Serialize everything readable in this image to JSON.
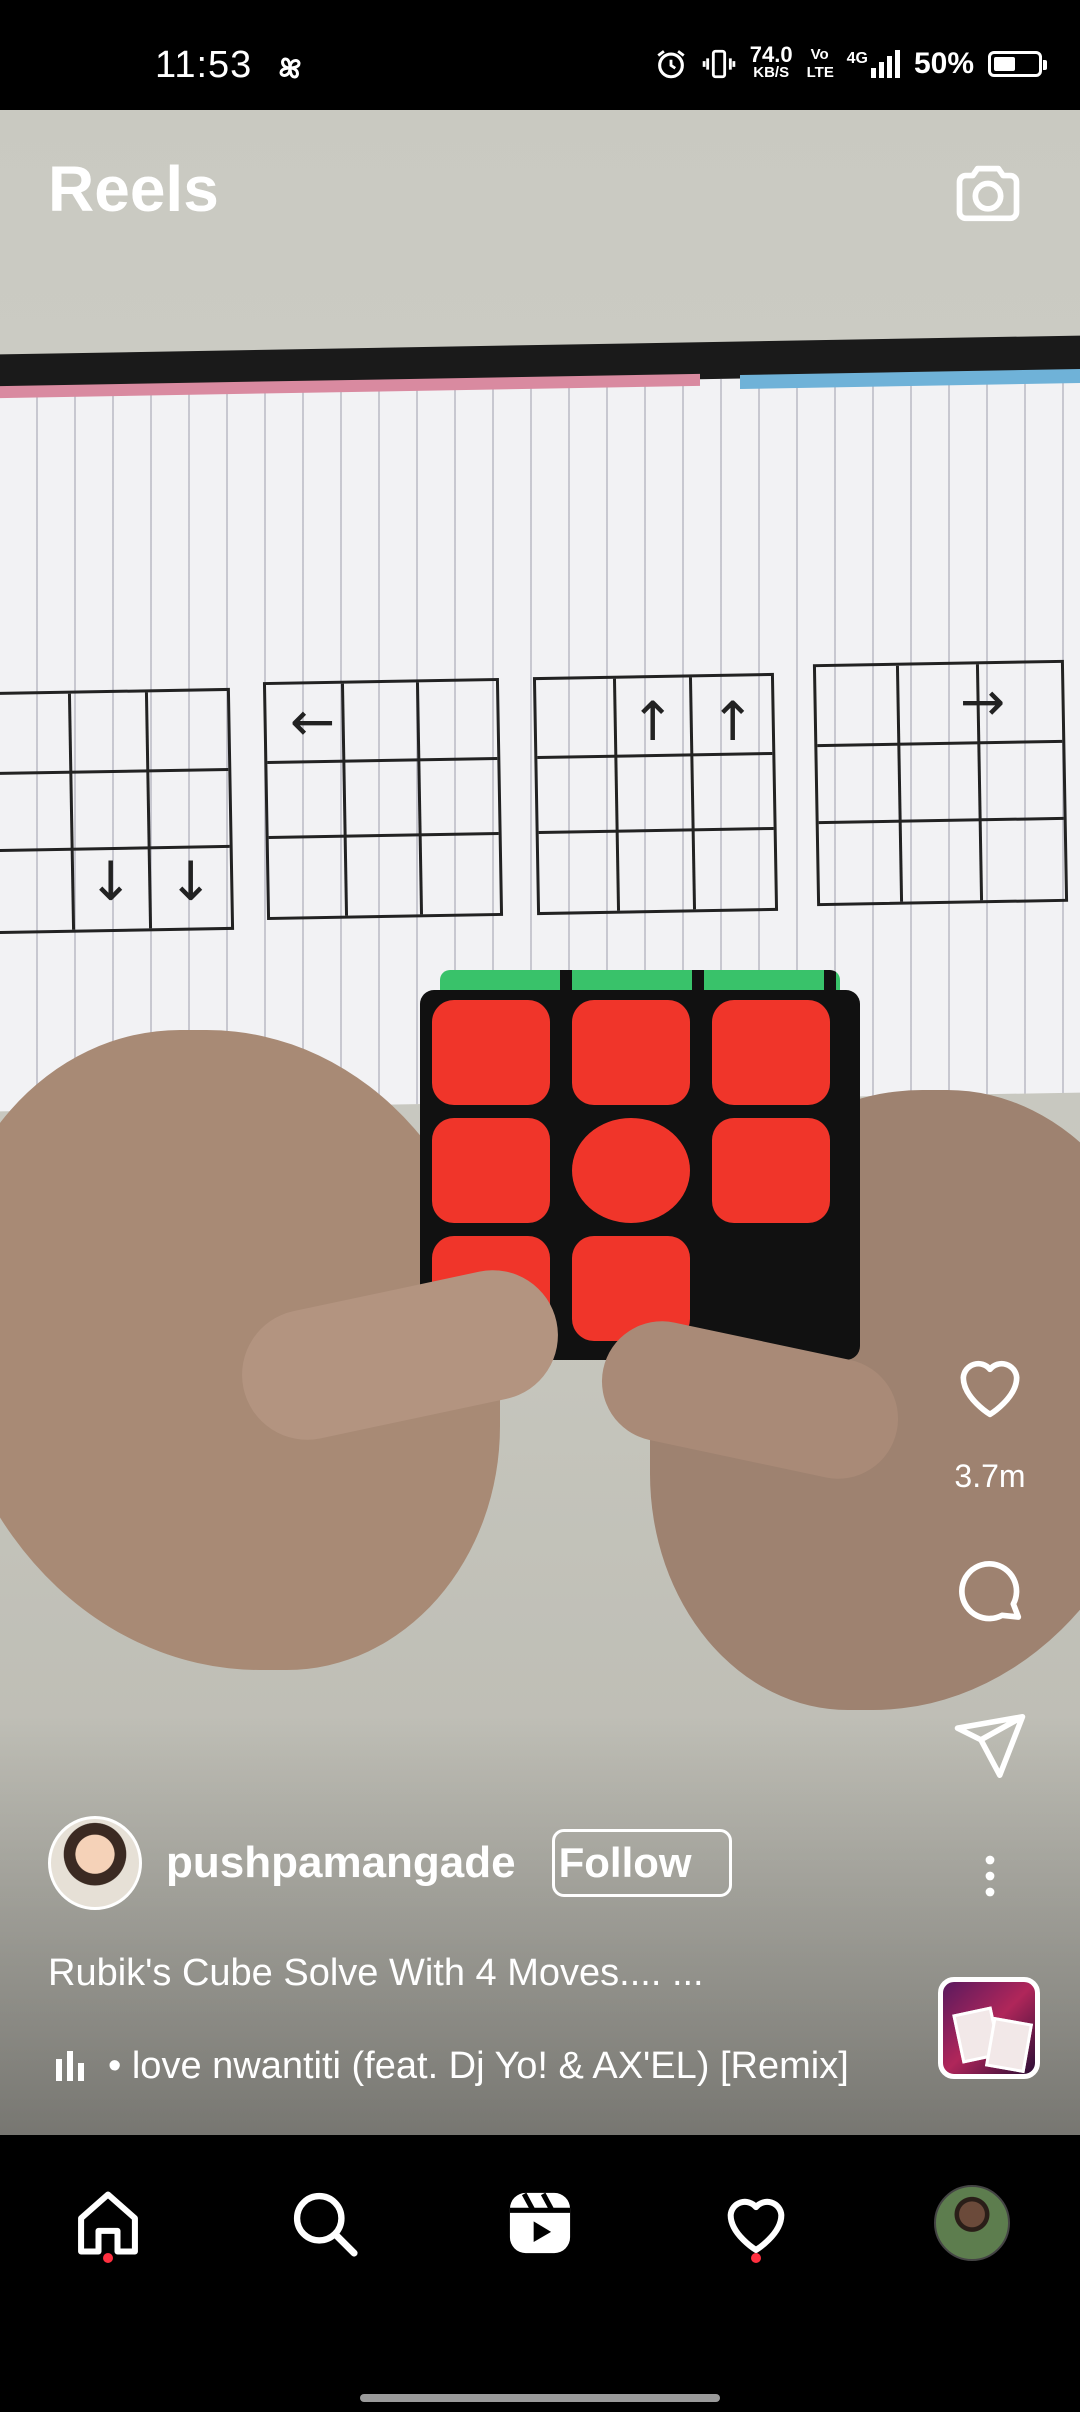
{
  "status_bar": {
    "time": "11:53",
    "net_speed_value": "74.0",
    "net_speed_unit": "KB/S",
    "volte": "Vo LTE",
    "network": "4G",
    "battery_percent": "50%",
    "battery_level": 0.5,
    "icons": [
      "pinwheel-icon",
      "alarm-icon",
      "vibrate-icon",
      "signal-icon",
      "battery-icon"
    ]
  },
  "header": {
    "title": "Reels",
    "camera_icon": "camera-icon"
  },
  "actions": {
    "like_icon": "heart-outline-icon",
    "like_count": "3.7m",
    "comment_icon": "comment-bubble-icon",
    "share_icon": "paper-plane-icon",
    "more_icon": "vertical-ellipsis-icon"
  },
  "post": {
    "username": "pushpamangade",
    "follow_label": "Follow",
    "caption": "Rubik's Cube Solve With 4 Moves.... ...",
    "music_text": "• love nwantiti (feat. Dj Yo! & AX'EL) [Remix]"
  },
  "bottom_nav": {
    "items": [
      {
        "name": "home",
        "icon": "home-icon",
        "has_notification": true
      },
      {
        "name": "search",
        "icon": "search-icon",
        "has_notification": false
      },
      {
        "name": "reels",
        "icon": "reels-icon",
        "has_notification": false
      },
      {
        "name": "activity",
        "icon": "heart-icon",
        "has_notification": true
      },
      {
        "name": "profile",
        "icon": "profile-avatar",
        "has_notification": false
      }
    ]
  },
  "colors": {
    "notification_dot": "#ff3040",
    "background": "#000000",
    "text": "#ffffff"
  }
}
